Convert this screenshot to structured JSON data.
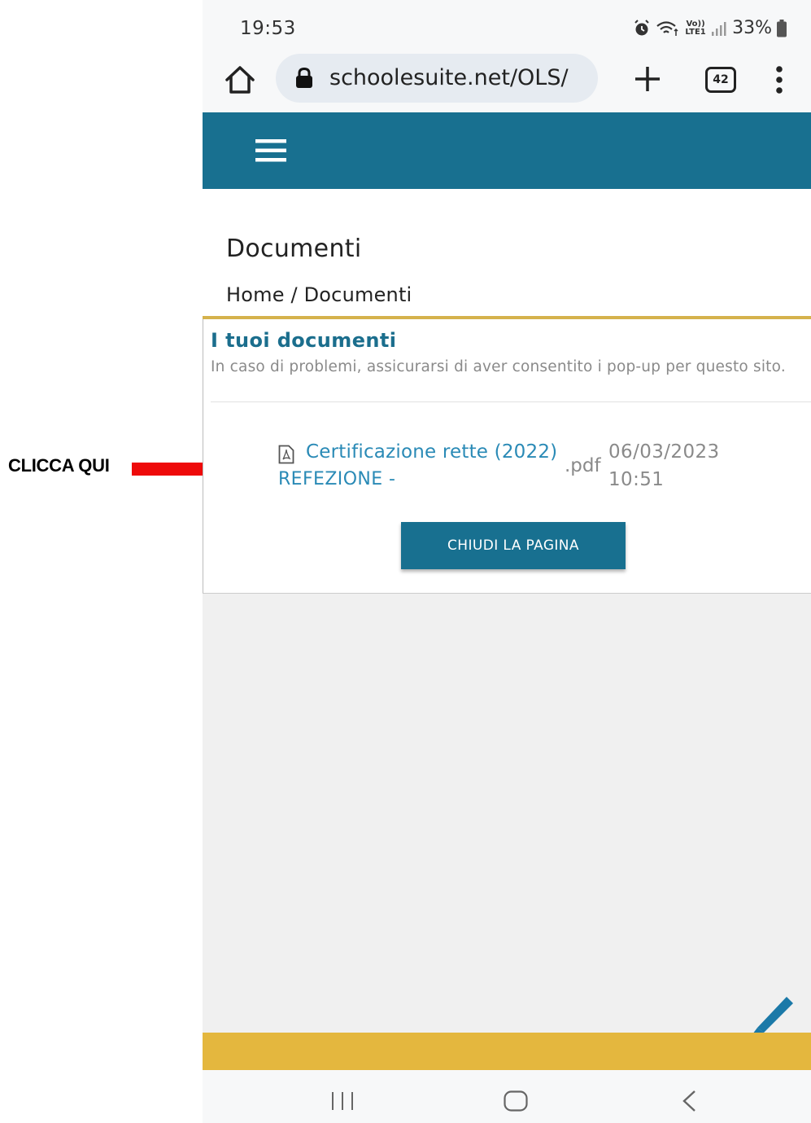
{
  "annotation": {
    "label": "CLICCA QUI",
    "arrow_color": "#ee0a0a"
  },
  "status_bar": {
    "time": "19:53",
    "battery": "33%",
    "network_label": "Vo)) LTE1"
  },
  "browser": {
    "url": "schoolesuite.net/OLS/",
    "tab_count": "42"
  },
  "page": {
    "title": "Documenti",
    "breadcrumb": "Home / Documenti"
  },
  "documents": {
    "heading": "I tuoi documenti",
    "description": "In caso di problemi, assicurarsi di aver consentito i pop-up per questo sito.",
    "items": [
      {
        "name_line1": "Certificazione rette (2022)",
        "name_line2": "REFEZIONE -",
        "extension": ".pdf",
        "date": "06/03/2023",
        "time": "10:51"
      }
    ],
    "close_button_label": "CHIUDI LA PAGINA"
  },
  "colors": {
    "header_bg": "#187090",
    "accent_gold": "#d5b24c",
    "footer_gold": "#e4b73e",
    "link": "#2a8ab6"
  }
}
